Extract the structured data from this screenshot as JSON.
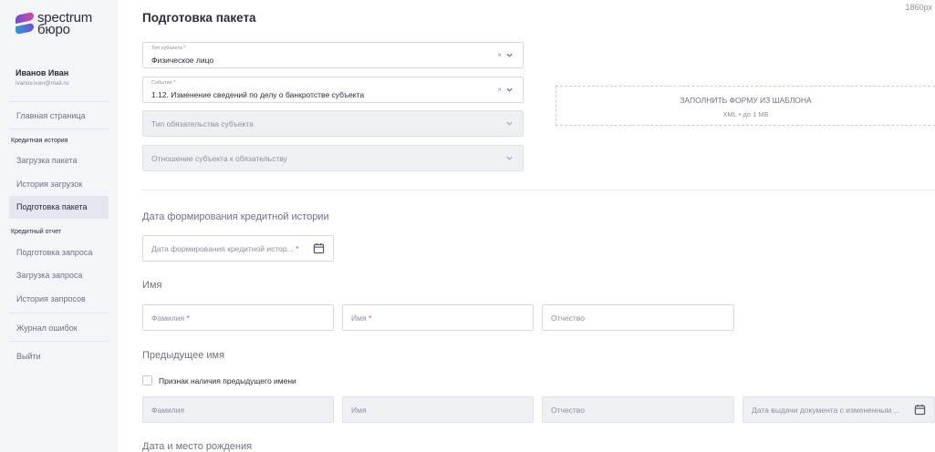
{
  "brand": {
    "line1": "spectrum",
    "line2": "бюро"
  },
  "user": {
    "name": "Иванов Иван",
    "email": "ivanov.ivan@mail.ru"
  },
  "sidebar": {
    "home": "Главная страница",
    "group_credit_history": "Кредитная история",
    "upload_package": "Загрузка пакета",
    "upload_history": "История загрузок",
    "prepare_package": "Подготовка пакета",
    "group_credit_report": "Кредитный отчет",
    "prepare_request": "Подготовка запроса",
    "upload_request": "Загрузка запроса",
    "request_history": "История запросов",
    "error_log": "Журнал ошибок",
    "logout": "Выйти"
  },
  "header": {
    "title": "Подготовка пакета",
    "width_label": "1860px"
  },
  "form": {
    "subject_type": {
      "label": "Тип субъекта",
      "required_mark": "*",
      "value": "Физическое лицо",
      "clear": "×"
    },
    "event": {
      "label": "Событие",
      "required_mark": "*",
      "value": "1.12. Изменение сведений по делу о банкротстве субъекта",
      "clear": "×"
    },
    "obligation_type": {
      "placeholder": "Тип обязательства субъекта"
    },
    "subject_relation": {
      "placeholder": "Отношение субъекта к обязательству"
    }
  },
  "template": {
    "title": "ЗАПОЛНИТЬ ФОРМУ ИЗ ШАБЛОНА",
    "hint": "XML • до 1 МБ"
  },
  "sections": {
    "history_date": {
      "title": "Дата формирования кредитной истории",
      "field_placeholder": "Дата формирования кредитной истор...",
      "required_mark": "*"
    },
    "name": {
      "title": "Имя",
      "surname": "Фамилия",
      "first_name": "Имя",
      "patronymic": "Отчество",
      "required_mark": "*"
    },
    "previous_name": {
      "title": "Предыдущее имя",
      "checkbox_label": "Признак наличия предыдущего имени",
      "surname": "Фамилия",
      "first_name": "Имя",
      "patronymic": "Отчество",
      "doc_date": "Дата выдачи документа с измененным ..."
    },
    "birth": {
      "title": "Дата и место рождения"
    }
  }
}
